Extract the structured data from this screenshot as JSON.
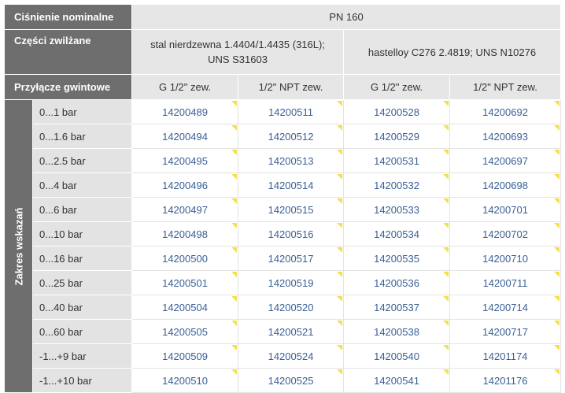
{
  "header": {
    "nominal_pressure_label": "Ciśnienie nominalne",
    "nominal_pressure_value": "PN 160",
    "wetted_parts_label": "Części zwilżane",
    "wetted_parts_values": [
      "stal nierdzewna 1.4404/1.4435 (316L); UNS S31603",
      "hastelloy C276 2.4819; UNS N10276"
    ],
    "thread_connection_label": "Przyłącze gwintowe",
    "thread_values": [
      "G 1/2\" zew.",
      "1/2\" NPT zew.",
      "G 1/2\" zew.",
      "1/2\" NPT zew."
    ]
  },
  "range_label": "Zakres wskazań",
  "rows": [
    {
      "range": "0...1 bar",
      "codes": [
        "14200489",
        "14200511",
        "14200528",
        "14200692"
      ]
    },
    {
      "range": "0...1.6 bar",
      "codes": [
        "14200494",
        "14200512",
        "14200529",
        "14200693"
      ]
    },
    {
      "range": "0...2.5 bar",
      "codes": [
        "14200495",
        "14200513",
        "14200531",
        "14200697"
      ]
    },
    {
      "range": "0...4 bar",
      "codes": [
        "14200496",
        "14200514",
        "14200532",
        "14200698"
      ]
    },
    {
      "range": "0...6 bar",
      "codes": [
        "14200497",
        "14200515",
        "14200533",
        "14200701"
      ]
    },
    {
      "range": "0...10 bar",
      "codes": [
        "14200498",
        "14200516",
        "14200534",
        "14200702"
      ]
    },
    {
      "range": "0...16 bar",
      "codes": [
        "14200500",
        "14200517",
        "14200535",
        "14200710"
      ]
    },
    {
      "range": "0...25 bar",
      "codes": [
        "14200501",
        "14200519",
        "14200536",
        "14200711"
      ]
    },
    {
      "range": "0...40 bar",
      "codes": [
        "14200504",
        "14200520",
        "14200537",
        "14200714"
      ]
    },
    {
      "range": "0...60 bar",
      "codes": [
        "14200505",
        "14200521",
        "14200538",
        "14200717"
      ]
    },
    {
      "range": "-1...+9 bar",
      "codes": [
        "14200509",
        "14200524",
        "14200540",
        "14201174"
      ]
    },
    {
      "range": "-1...+10 bar",
      "codes": [
        "14200510",
        "14200525",
        "14200541",
        "14201176"
      ]
    }
  ],
  "colors": {
    "header_dark": "#6e6e6e",
    "header_light": "#e6e6e6",
    "link": "#3a5f95",
    "flag": "#f1e24c"
  }
}
